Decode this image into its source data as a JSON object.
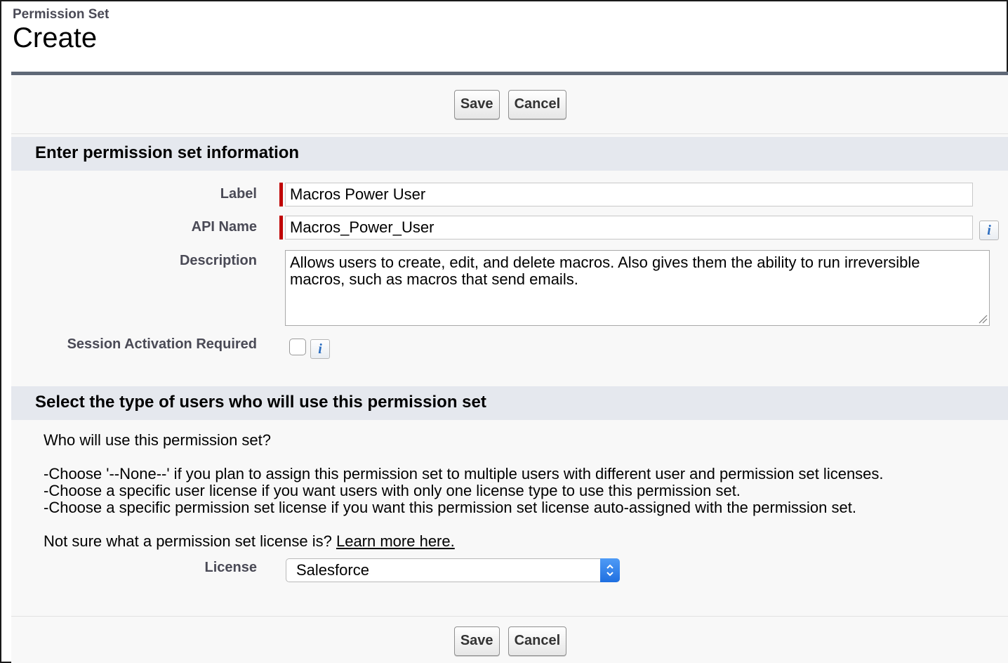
{
  "header": {
    "subtitle": "Permission Set",
    "title": "Create"
  },
  "toolbar": {
    "save_label": "Save",
    "cancel_label": "Cancel"
  },
  "section1": {
    "heading": "Enter permission set information",
    "label_field": {
      "label": "Label",
      "value": "Macros Power User"
    },
    "api_field": {
      "label": "API Name",
      "value": "Macros_Power_User"
    },
    "description_field": {
      "label": "Description",
      "line1": "Allows users to create, edit, and delete macros. Also gives them the ability to run irreversible",
      "line2": "macros, such as macros that send emails."
    },
    "session_field": {
      "label": "Session Activation Required",
      "checked": false
    }
  },
  "section2": {
    "heading": "Select the type of users who will use this permission set",
    "question": "Who will use this permission set?",
    "bullets": [
      "-Choose '--None--' if you plan to assign this permission set to multiple users with different user and permission set licenses.",
      "-Choose a specific user license if you want users with only one license type to use this permission set.",
      "-Choose a specific permission set license if you want this permission set license auto-assigned with the permission set."
    ],
    "help_prefix": "Not sure what a permission set license is? ",
    "help_link": "Learn more here.",
    "license_field": {
      "label": "License",
      "selected": "Salesforce"
    }
  },
  "icons": {
    "info": "info-icon",
    "select_arrows": "up-down-chevron-icon",
    "resize": "resize-grip-icon"
  },
  "colors": {
    "required": "#c00000",
    "section_header": "#e5e8ee",
    "panel_border": "#5f6877",
    "info_accent": "#2a6cc0",
    "select_accent": "#1f6fe0"
  }
}
